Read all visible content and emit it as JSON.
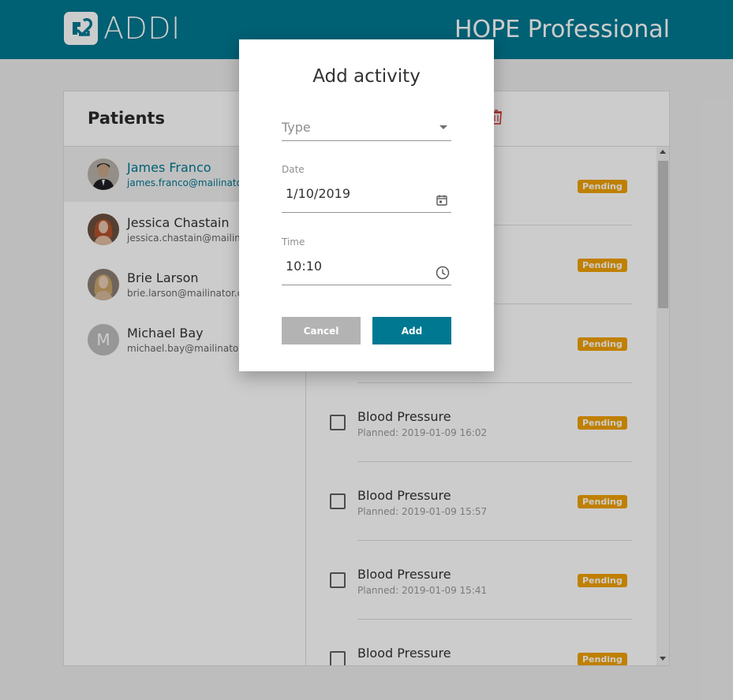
{
  "header": {
    "logo_text": "ADDI",
    "app_title": "HOPE Professional"
  },
  "patients_panel": {
    "title": "Patients",
    "patients": [
      {
        "name": "James Franco",
        "email": "james.franco@mailinato",
        "avatar": "photo",
        "selected": true
      },
      {
        "name": "Jessica Chastain",
        "email": "jessica.chastain@mailin",
        "avatar": "photo",
        "selected": false
      },
      {
        "name": "Brie Larson",
        "email": "brie.larson@mailinator.c",
        "avatar": "photo",
        "selected": false
      },
      {
        "name": "Michael Bay",
        "email": "michael.bay@mailinato",
        "avatar": "M",
        "selected": false
      }
    ]
  },
  "activities": [
    {
      "title": "",
      "planned": "",
      "status": "Pending"
    },
    {
      "title": "",
      "planned": "",
      "status": "Pending"
    },
    {
      "title": "",
      "planned": "",
      "status": "Pending"
    },
    {
      "title": "Blood Pressure",
      "planned": "Planned: 2019-01-09 16:02",
      "status": "Pending"
    },
    {
      "title": "Blood Pressure",
      "planned": "Planned: 2019-01-09 15:57",
      "status": "Pending"
    },
    {
      "title": "Blood Pressure",
      "planned": "Planned: 2019-01-09 15:41",
      "status": "Pending"
    },
    {
      "title": "Blood Pressure",
      "planned": "",
      "status": "Pending"
    }
  ],
  "dialog": {
    "title": "Add activity",
    "type_placeholder": "Type",
    "date_label": "Date",
    "date_value": "1/10/2019",
    "time_label": "Time",
    "time_value": "10:10",
    "cancel_label": "Cancel",
    "add_label": "Add"
  },
  "colors": {
    "brand": "#007892",
    "badge": "#f0a000",
    "cancel": "#b3b3b3"
  },
  "icons": [
    "addi-logo-icon",
    "trash-icon",
    "dropdown-caret-icon",
    "calendar-icon",
    "clock-icon"
  ]
}
